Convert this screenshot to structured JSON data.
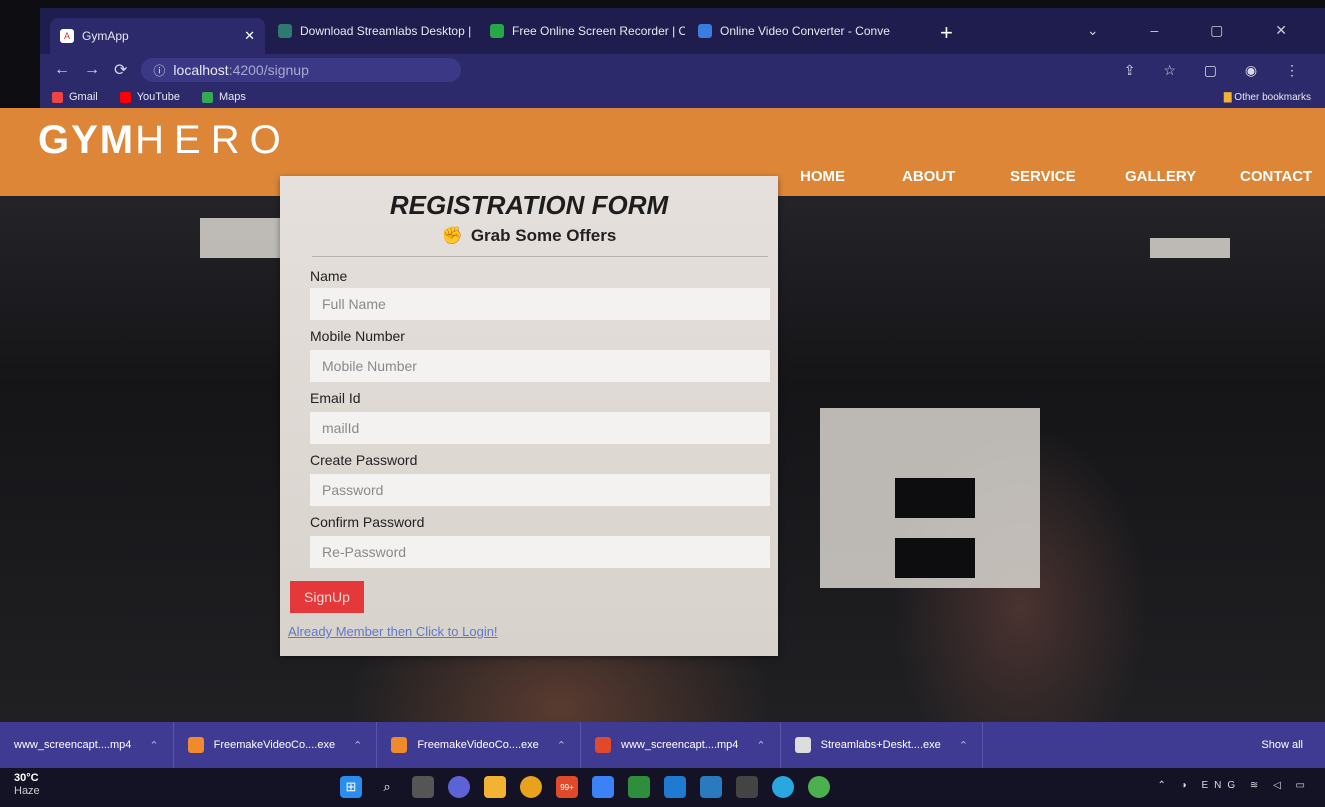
{
  "browser": {
    "tabs": [
      {
        "title": "GymApp",
        "active": true
      },
      {
        "title": "Download Streamlabs Desktop |",
        "active": false
      },
      {
        "title": "Free Online Screen Recorder | O",
        "active": false
      },
      {
        "title": "Online Video Converter - Conve",
        "active": false
      }
    ],
    "url_host": "localhost",
    "url_path": ":4200/signup",
    "bookmarks": [
      "Gmail",
      "YouTube",
      "Maps"
    ],
    "other_bookmarks": "Other bookmarks"
  },
  "site": {
    "logo_bold": "GYM",
    "logo_light": "HERO",
    "nav": [
      "HOME",
      "ABOUT",
      "SERVICE",
      "GALLERY",
      "CONTACT"
    ],
    "brand_color": "#dd8638"
  },
  "form": {
    "title": "REGISTRATION FORM",
    "subtitle": "Grab Some Offers",
    "fields": [
      {
        "label": "Name",
        "placeholder": "Full Name"
      },
      {
        "label": "Mobile Number",
        "placeholder": "Mobile Number"
      },
      {
        "label": "Email Id",
        "placeholder": "mailId"
      },
      {
        "label": "Create Password",
        "placeholder": "Password"
      },
      {
        "label": "Confirm Password",
        "placeholder": "Re-Password"
      }
    ],
    "submit": "SignUp",
    "login_link": "Already Member then Click to Login!"
  },
  "downloads": {
    "items": [
      "www_screencapt....mp4",
      "FreemakeVideoCo....exe",
      "FreemakeVideoCo....exe",
      "www_screencapt....mp4",
      "Streamlabs+Deskt....exe"
    ],
    "show_all": "Show all"
  },
  "taskbar": {
    "temperature": "30°C",
    "condition": "Haze",
    "badge": "99+",
    "language": "ENG"
  }
}
